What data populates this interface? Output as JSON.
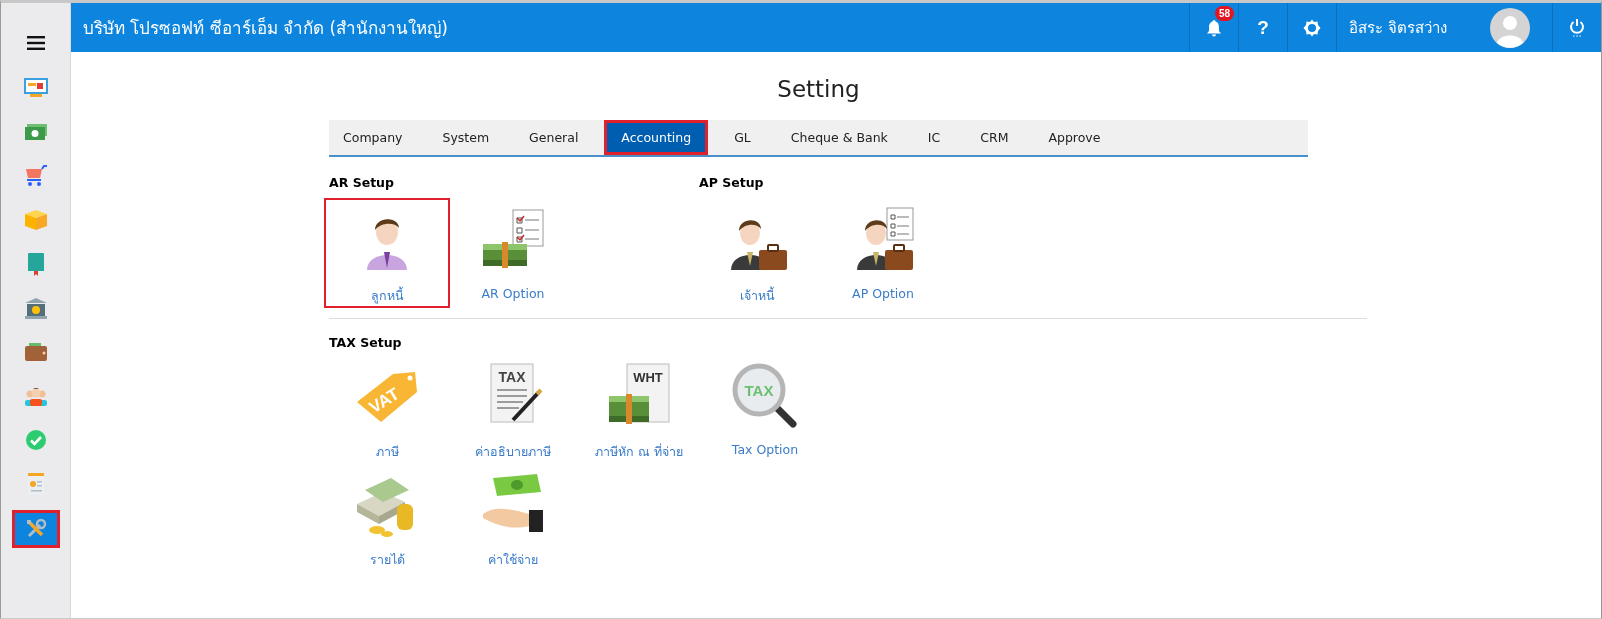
{
  "header": {
    "company": "บริษัท โปรซอฟท์ ซีอาร์เอ็ม จำกัด (สำนักงานใหญ่)",
    "notification_count": "58",
    "help": "?",
    "user_name": "อิสระ จิตรสว่าง"
  },
  "sidebar": {
    "items": [
      {
        "kind": "monitor",
        "selected": false
      },
      {
        "kind": "banknote",
        "selected": false
      },
      {
        "kind": "cart",
        "selected": false
      },
      {
        "kind": "box",
        "selected": false
      },
      {
        "kind": "book",
        "selected": false
      },
      {
        "kind": "bank",
        "selected": false
      },
      {
        "kind": "wallet",
        "selected": false
      },
      {
        "kind": "people",
        "selected": false
      },
      {
        "kind": "check",
        "selected": false
      },
      {
        "kind": "document",
        "selected": false
      },
      {
        "kind": "tools",
        "selected": true
      }
    ]
  },
  "page": {
    "title": "Setting"
  },
  "tabs": [
    {
      "label": "Company",
      "selected": false
    },
    {
      "label": "System",
      "selected": false
    },
    {
      "label": "General",
      "selected": false
    },
    {
      "label": "Accounting",
      "selected": true
    },
    {
      "label": "GL",
      "selected": false
    },
    {
      "label": "Cheque & Bank",
      "selected": false
    },
    {
      "label": "IC",
      "selected": false
    },
    {
      "label": "CRM",
      "selected": false
    },
    {
      "label": "Approve",
      "selected": false
    }
  ],
  "sections": [
    {
      "title": "AR Setup",
      "items": [
        {
          "label": "ลูกหนี้",
          "kind": "customer",
          "selected": true
        },
        {
          "label": "AR Option",
          "kind": "money-checklist",
          "selected": false
        }
      ]
    },
    {
      "title": "AP Setup",
      "items": [
        {
          "label": "เจ้าหนี้",
          "kind": "supplier",
          "selected": false
        },
        {
          "label": "AP Option",
          "kind": "supplier-checklist",
          "selected": false
        }
      ]
    },
    {
      "title": "TAX Setup",
      "items": [
        {
          "label": "ภาษี",
          "kind": "vat-tag",
          "tag": "VAT",
          "selected": false
        },
        {
          "label": "ค่าอธิบายภาษี",
          "kind": "tax-paper",
          "tag": "TAX",
          "selected": false
        },
        {
          "label": "ภาษีหัก ณ ที่จ่าย",
          "kind": "wht-paper",
          "tag": "WHT",
          "selected": false
        },
        {
          "label": "Tax Option",
          "kind": "magnifier",
          "tag": "TAX",
          "selected": false
        },
        {
          "label": "รายได้",
          "kind": "cash-coins",
          "selected": false
        },
        {
          "label": "ค่าใช้จ่าย",
          "kind": "hand-cash",
          "selected": false
        }
      ]
    }
  ]
}
